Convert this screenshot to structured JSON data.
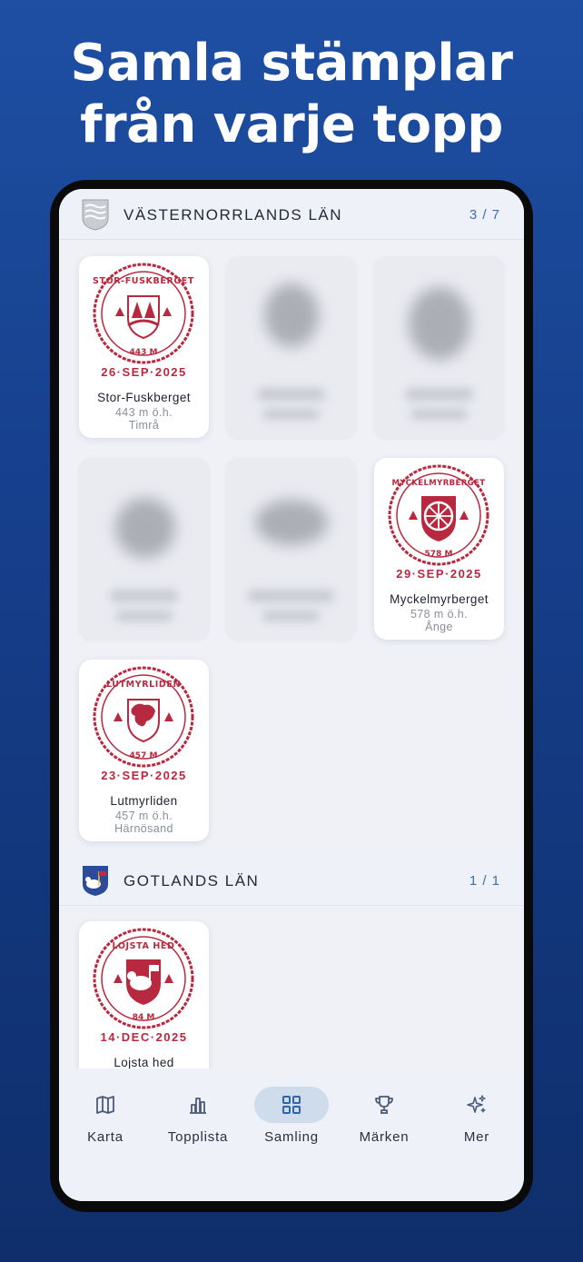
{
  "headline": {
    "line1": "Samla stämplar",
    "line2": "från varje topp"
  },
  "sections": [
    {
      "title": "VÄSTERNORRLANDS LÄN",
      "count": "3 / 7",
      "cards": [
        {
          "name": "Stor-Fuskberget",
          "elevation": "443 m ö.h.",
          "municipality": "Timrå",
          "date": "26·SEP·2025",
          "stamp_text": "STOR-FUSKBERGET",
          "stamp_elev": "443 M",
          "locked": false
        },
        {
          "locked": true
        },
        {
          "locked": true
        },
        {
          "locked": true
        },
        {
          "locked": true
        },
        {
          "name": "Myckelmyrberget",
          "elevation": "578 m ö.h.",
          "municipality": "Ånge",
          "date": "29·SEP·2025",
          "stamp_text": "MYCKELMYRBERGET",
          "stamp_elev": "578 M",
          "locked": false
        },
        {
          "name": "Lutmyrliden",
          "elevation": "457 m ö.h.",
          "municipality": "Härnösand",
          "date": "23·SEP·2025",
          "stamp_text": "LUTMYRLIDEN",
          "stamp_elev": "457 M",
          "locked": false
        }
      ]
    },
    {
      "title": "GOTLANDS LÄN",
      "count": "1 / 1",
      "cards": [
        {
          "name": "Lojsta hed",
          "date": "14·DEC·2025",
          "stamp_text": "LOJSTA HED",
          "stamp_elev": "84 M",
          "locked": false
        }
      ]
    }
  ],
  "nav": [
    {
      "label": "Karta",
      "icon": "map-icon",
      "active": false
    },
    {
      "label": "Topplista",
      "icon": "bar-chart-icon",
      "active": false
    },
    {
      "label": "Samling",
      "icon": "grid-icon",
      "active": true
    },
    {
      "label": "Märken",
      "icon": "trophy-icon",
      "active": false
    },
    {
      "label": "Mer",
      "icon": "sparkles-icon",
      "active": false
    }
  ],
  "colors": {
    "stamp_red": "#b8283e",
    "accent_blue": "#3a6fb0",
    "active_pill": "#cfdcec"
  }
}
